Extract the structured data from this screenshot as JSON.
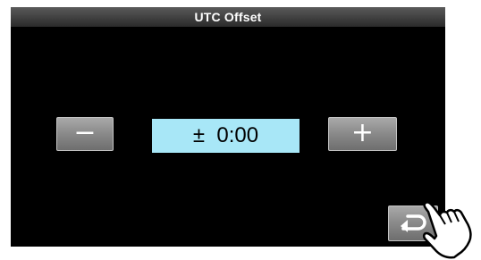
{
  "screen": {
    "title": "UTC Offset"
  },
  "offset": {
    "decrease_label": "−",
    "value": "±  0:00",
    "increase_label": "+"
  },
  "icons": {
    "back": "return-arrow-icon",
    "pointer": "pointing-hand-icon"
  },
  "colors": {
    "screen_background": "#000000",
    "value_background": "#a8e7f7",
    "button_gray": "#8c8c8c"
  }
}
